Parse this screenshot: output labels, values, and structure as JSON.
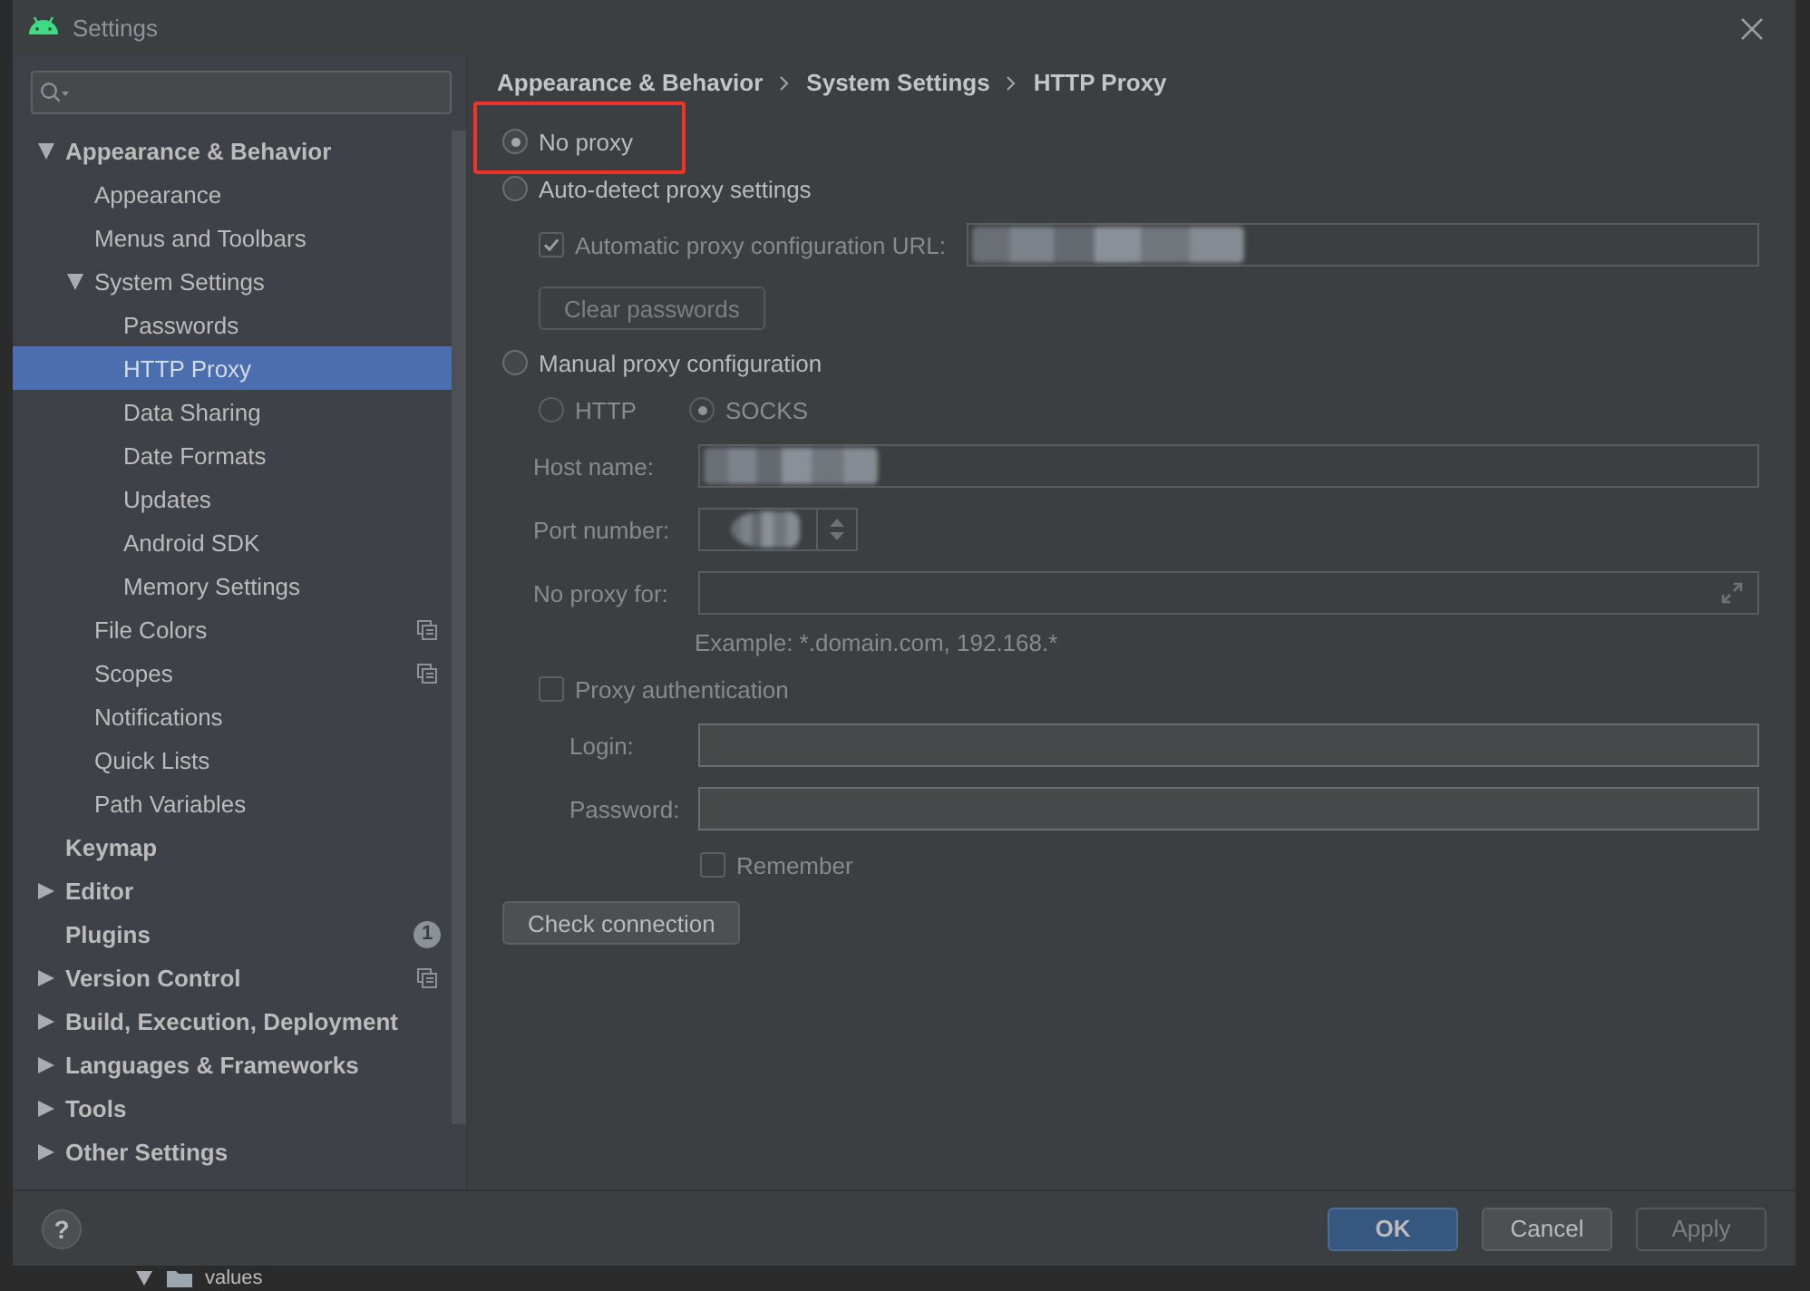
{
  "window": {
    "title": "Settings"
  },
  "sidebar": {
    "items": [
      {
        "label": "Appearance & Behavior",
        "kind": "group",
        "expanded": true,
        "selected": false,
        "project_level": false,
        "children": [
          {
            "label": "Appearance",
            "kind": "page",
            "selected": false,
            "project_level": false
          },
          {
            "label": "Menus and Toolbars",
            "kind": "page",
            "selected": false,
            "project_level": false
          },
          {
            "label": "System Settings",
            "kind": "group",
            "expanded": true,
            "selected": false,
            "project_level": false,
            "children": [
              {
                "label": "Passwords",
                "kind": "page",
                "selected": false,
                "project_level": false
              },
              {
                "label": "HTTP Proxy",
                "kind": "page",
                "selected": true,
                "project_level": false
              },
              {
                "label": "Data Sharing",
                "kind": "page",
                "selected": false,
                "project_level": false
              },
              {
                "label": "Date Formats",
                "kind": "page",
                "selected": false,
                "project_level": false
              },
              {
                "label": "Updates",
                "kind": "page",
                "selected": false,
                "project_level": false
              },
              {
                "label": "Android SDK",
                "kind": "page",
                "selected": false,
                "project_level": false
              },
              {
                "label": "Memory Settings",
                "kind": "page",
                "selected": false,
                "project_level": false
              }
            ]
          },
          {
            "label": "File Colors",
            "kind": "page",
            "selected": false,
            "project_level": true
          },
          {
            "label": "Scopes",
            "kind": "page",
            "selected": false,
            "project_level": true
          },
          {
            "label": "Notifications",
            "kind": "page",
            "selected": false,
            "project_level": false
          },
          {
            "label": "Quick Lists",
            "kind": "page",
            "selected": false,
            "project_level": false
          },
          {
            "label": "Path Variables",
            "kind": "page",
            "selected": false,
            "project_level": false
          }
        ]
      },
      {
        "label": "Keymap",
        "kind": "page",
        "selected": false,
        "project_level": false
      },
      {
        "label": "Editor",
        "kind": "group",
        "expanded": false,
        "selected": false,
        "project_level": false
      },
      {
        "label": "Plugins",
        "kind": "page",
        "selected": false,
        "project_level": false,
        "badge": "1"
      },
      {
        "label": "Version Control",
        "kind": "group",
        "expanded": false,
        "selected": false,
        "project_level": true
      },
      {
        "label": "Build, Execution, Deployment",
        "kind": "group",
        "expanded": false,
        "selected": false,
        "project_level": false
      },
      {
        "label": "Languages & Frameworks",
        "kind": "group",
        "expanded": false,
        "selected": false,
        "project_level": false
      },
      {
        "label": "Tools",
        "kind": "group",
        "expanded": false,
        "selected": false,
        "project_level": false
      },
      {
        "label": "Other Settings",
        "kind": "group",
        "expanded": false,
        "selected": false,
        "project_level": false
      }
    ]
  },
  "breadcrumb": [
    "Appearance & Behavior",
    "System Settings",
    "HTTP Proxy"
  ],
  "proxy_mode": [
    {
      "label": "No proxy",
      "selected": true,
      "highlighted": true
    },
    {
      "label": "Auto-detect proxy settings",
      "selected": false,
      "highlighted": false
    },
    {
      "label": "Manual proxy configuration",
      "selected": false,
      "highlighted": false
    }
  ],
  "auto_detect": {
    "disabled": true,
    "checkbox": {
      "label": "Automatic proxy configuration URL:",
      "checked": true
    },
    "url_field": {
      "redacted": true
    },
    "clear_button": {
      "label": "Clear passwords"
    }
  },
  "manual": {
    "disabled": true,
    "protocols": [
      {
        "label": "HTTP",
        "selected": false
      },
      {
        "label": "SOCKS",
        "selected": true
      }
    ],
    "fields": [
      {
        "kind": "text",
        "label": "Host name:",
        "redacted": true
      },
      {
        "kind": "spinner",
        "label": "Port number:",
        "redacted": true
      },
      {
        "kind": "expandable",
        "label": "No proxy for:",
        "redacted": false
      }
    ],
    "hint": "Example: *.domain.com, 192.168.*",
    "auth": {
      "label": "Proxy authentication",
      "checked": false
    },
    "auth_fields": [
      {
        "label": "Login:"
      },
      {
        "label": "Password:"
      }
    ],
    "remember": {
      "label": "Remember",
      "checked": false
    }
  },
  "check_button": {
    "label": "Check connection"
  },
  "footer": {
    "help": "?",
    "buttons": [
      {
        "label": "OK",
        "kind": "default",
        "disabled": false
      },
      {
        "label": "Cancel",
        "kind": "normal",
        "disabled": false
      },
      {
        "label": "Apply",
        "kind": "normal",
        "disabled": true
      }
    ]
  },
  "background": {
    "folder": "values"
  }
}
